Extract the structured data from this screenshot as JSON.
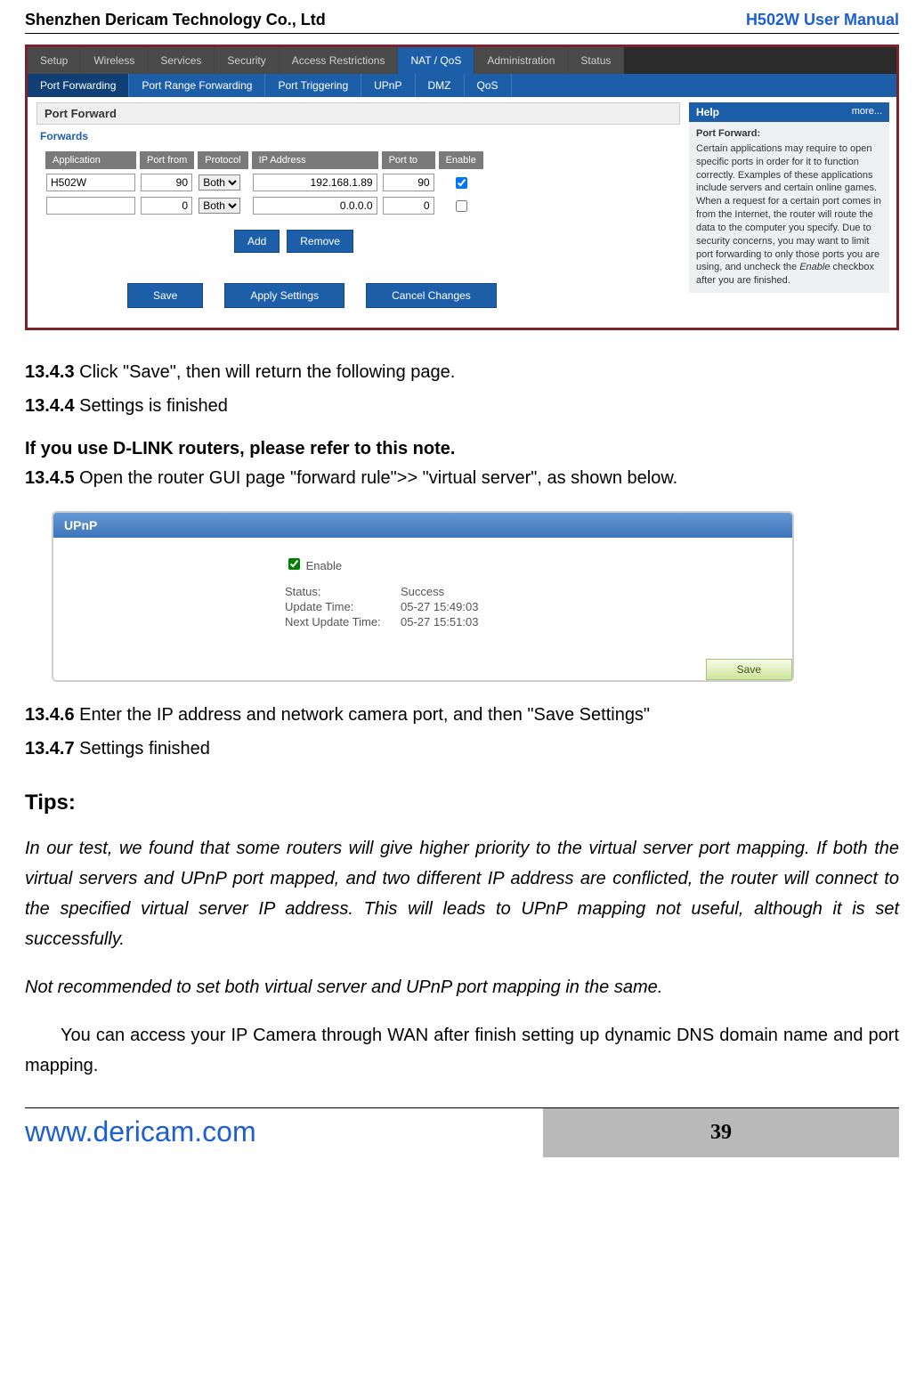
{
  "header": {
    "company": "Shenzhen Dericam Technology Co., Ltd",
    "product": "H502W User Manual"
  },
  "router1": {
    "tabs_top": [
      "Setup",
      "Wireless",
      "Services",
      "Security",
      "Access Restrictions",
      "NAT / QoS",
      "Administration",
      "Status"
    ],
    "tabs_top_active": 5,
    "tabs_sub": [
      "Port Forwarding",
      "Port Range Forwarding",
      "Port Triggering",
      "UPnP",
      "DMZ",
      "QoS"
    ],
    "tabs_sub_active": 0,
    "section_title": "Port Forward",
    "forwards_label": "Forwards",
    "columns": [
      "Application",
      "Port from",
      "Protocol",
      "IP Address",
      "Port to",
      "Enable"
    ],
    "rows": [
      {
        "app": "H502W",
        "pfrom": "90",
        "proto": "Both",
        "ip": "192.168.1.89",
        "pto": "90",
        "enable": true
      },
      {
        "app": "",
        "pfrom": "0",
        "proto": "Both",
        "ip": "0.0.0.0",
        "pto": "0",
        "enable": false
      }
    ],
    "btn_add": "Add",
    "btn_remove": "Remove",
    "btn_save": "Save",
    "btn_apply": "Apply Settings",
    "btn_cancel": "Cancel Changes",
    "help": {
      "title": "Help",
      "more": "more...",
      "heading": "Port Forward:",
      "body_pre": "Certain applications may require to open specific ports in order for it to function correctly. Examples of these applications include servers and certain online games. When a request for a certain port comes in from the Internet, the router will route the data to the computer you specify. Due to security concerns, you may want to limit port forwarding to only those ports you are using, and uncheck the ",
      "body_em": "Enable",
      "body_post": " checkbox after you are finished."
    }
  },
  "steps": {
    "s1343_num": "13.4.3",
    "s1343_text": " Click \"Save\", then will return the following page.",
    "s1344_num": "13.4.4",
    "s1344_text": " Settings is finished",
    "dlink_note": "If you use D-LINK routers, please refer to this note.",
    "s1345_num": "13.4.5",
    "s1345_text": " Open the router GUI page \"forward rule\">> \"virtual server\", as shown below.",
    "s1346_num": "13.4.6",
    "s1346_text": " Enter the IP address and network camera port, and then \"Save Settings\"",
    "s1347_num": "13.4.7",
    "s1347_text": " Settings finished"
  },
  "upnp": {
    "title": "UPnP",
    "enable": "Enable",
    "status_k": "Status:",
    "status_v": "Success",
    "update_k": "Update Time:",
    "update_v": "05-27 15:49:03",
    "next_k": "Next Update Time:",
    "next_v": "05-27 15:51:03",
    "save": "Save"
  },
  "tips": {
    "title": "Tips:",
    "p1": "In our test, we found that some routers will give higher priority to the virtual server port mapping. If both the virtual servers and UPnP port mapped, and two different IP address are conflicted, the router will connect to the specified virtual server IP address. This will leads to UPnP mapping not useful, although it is set successfully.",
    "p2": "Not recommended to set both virtual server and UPnP port mapping in the same.",
    "p3": "You can access your IP Camera through WAN after finish setting up dynamic DNS domain name and port mapping."
  },
  "footer": {
    "left": "www.dericam.com",
    "right": "39"
  }
}
